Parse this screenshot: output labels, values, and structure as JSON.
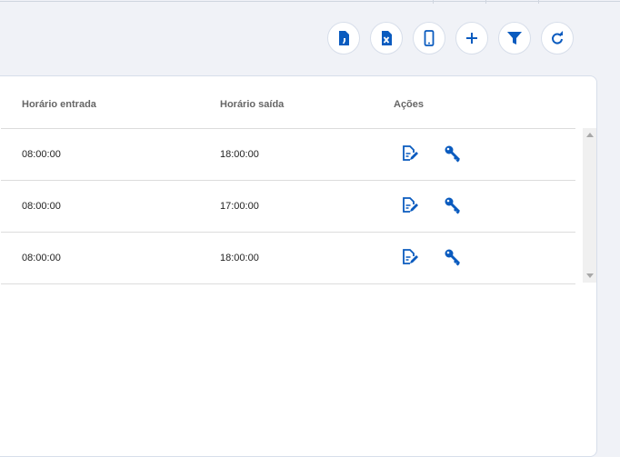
{
  "toolbar": {
    "buttons": [
      {
        "name": "export-csv-button",
        "icon": "file-csv-icon"
      },
      {
        "name": "export-excel-button",
        "icon": "file-excel-icon"
      },
      {
        "name": "mobile-button",
        "icon": "mobile-icon"
      },
      {
        "name": "add-button",
        "icon": "plus-icon"
      },
      {
        "name": "filter-button",
        "icon": "filter-icon"
      },
      {
        "name": "refresh-button",
        "icon": "refresh-icon"
      }
    ]
  },
  "table": {
    "headers": {
      "entrada": "Horário entrada",
      "saida": "Horário saída",
      "acoes": "Ações"
    },
    "rows": [
      {
        "entrada": "08:00:00",
        "saida": "18:00:00"
      },
      {
        "entrada": "08:00:00",
        "saida": "17:00:00"
      },
      {
        "entrada": "08:00:00",
        "saida": "18:00:00"
      }
    ]
  },
  "colors": {
    "accent": "#0a5bbf",
    "background": "#f0f2f7"
  }
}
